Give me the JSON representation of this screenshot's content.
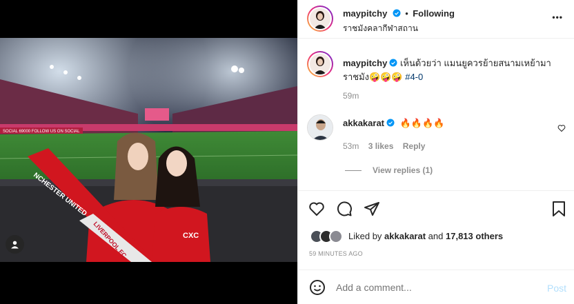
{
  "post": {
    "author": "maypitchy",
    "location": "ราชมังคลากีฬาสถาน",
    "follow_status": "Following",
    "more_label": "•••"
  },
  "caption": {
    "author": "maypitchy",
    "text_line1": "เห็นด้วยว่า แมนยูควรย้ายสนามเหย้ามา",
    "text_line2": "ราชมัง",
    "emojis": "🤪🤪🤪",
    "hashtag": "#4-0",
    "time": "59m"
  },
  "comment": {
    "author": "akkakarat",
    "text": "🔥🔥🔥🔥",
    "time": "53m",
    "likes": "3 likes",
    "reply_label": "Reply",
    "view_replies": "View replies (1)"
  },
  "likes": {
    "prefix": "Liked by",
    "user": "akkakarat",
    "connector": "and",
    "others": "17,813 others"
  },
  "timestamp": "59 MINUTES AGO",
  "add_comment": {
    "placeholder": "Add a comment...",
    "post_label": "Post"
  },
  "photo": {
    "scarf_text": "NCHESTER UNITED",
    "scarf_text2": "LIVERPOOL FC",
    "jersey_sponsor": "CXC",
    "ad_board": "SOCIAL 69000 FOLLOW US ON SOCIAL"
  },
  "colors": {
    "verified": "#0095f6",
    "post_button": "#b2dffc",
    "link": "#00376b"
  }
}
